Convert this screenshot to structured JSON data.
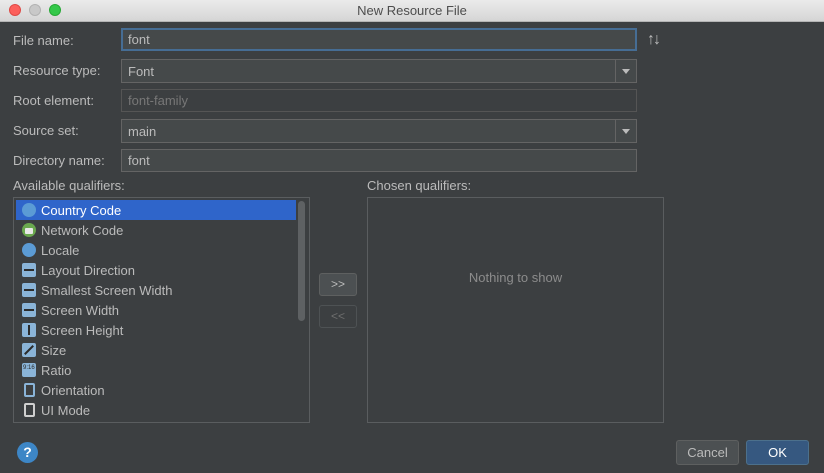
{
  "window": {
    "title": "New Resource File"
  },
  "form": {
    "file_name_label": "File name:",
    "file_name_value": "font",
    "resource_type_label": "Resource type:",
    "resource_type_value": "Font",
    "root_element_label": "Root element:",
    "root_element_value": "font-family",
    "source_set_label": "Source set:",
    "source_set_value": "main",
    "directory_name_label": "Directory name:",
    "directory_name_value": "font"
  },
  "available": {
    "label": "Available qualifiers:",
    "items": [
      {
        "label": "Country Code",
        "icon": "globe-icon"
      },
      {
        "label": "Network Code",
        "icon": "network-icon"
      },
      {
        "label": "Locale",
        "icon": "globe-icon"
      },
      {
        "label": "Layout Direction",
        "icon": "layout-direction-icon"
      },
      {
        "label": "Smallest Screen Width",
        "icon": "smallest-width-icon"
      },
      {
        "label": "Screen Width",
        "icon": "width-icon"
      },
      {
        "label": "Screen Height",
        "icon": "height-icon"
      },
      {
        "label": "Size",
        "icon": "size-icon"
      },
      {
        "label": "Ratio",
        "icon": "ratio-icon"
      },
      {
        "label": "Orientation",
        "icon": "orientation-icon"
      },
      {
        "label": "UI Mode",
        "icon": "ui-mode-icon"
      }
    ],
    "selected_index": 0
  },
  "move": {
    "add_label": ">>",
    "remove_label": "<<"
  },
  "chosen": {
    "label": "Chosen qualifiers:",
    "empty_text": "Nothing to show"
  },
  "buttons": {
    "help": "?",
    "cancel": "Cancel",
    "ok": "OK"
  },
  "colors": {
    "background": "#3c3f41",
    "selection": "#2f65ca",
    "ok_button": "#365880"
  }
}
